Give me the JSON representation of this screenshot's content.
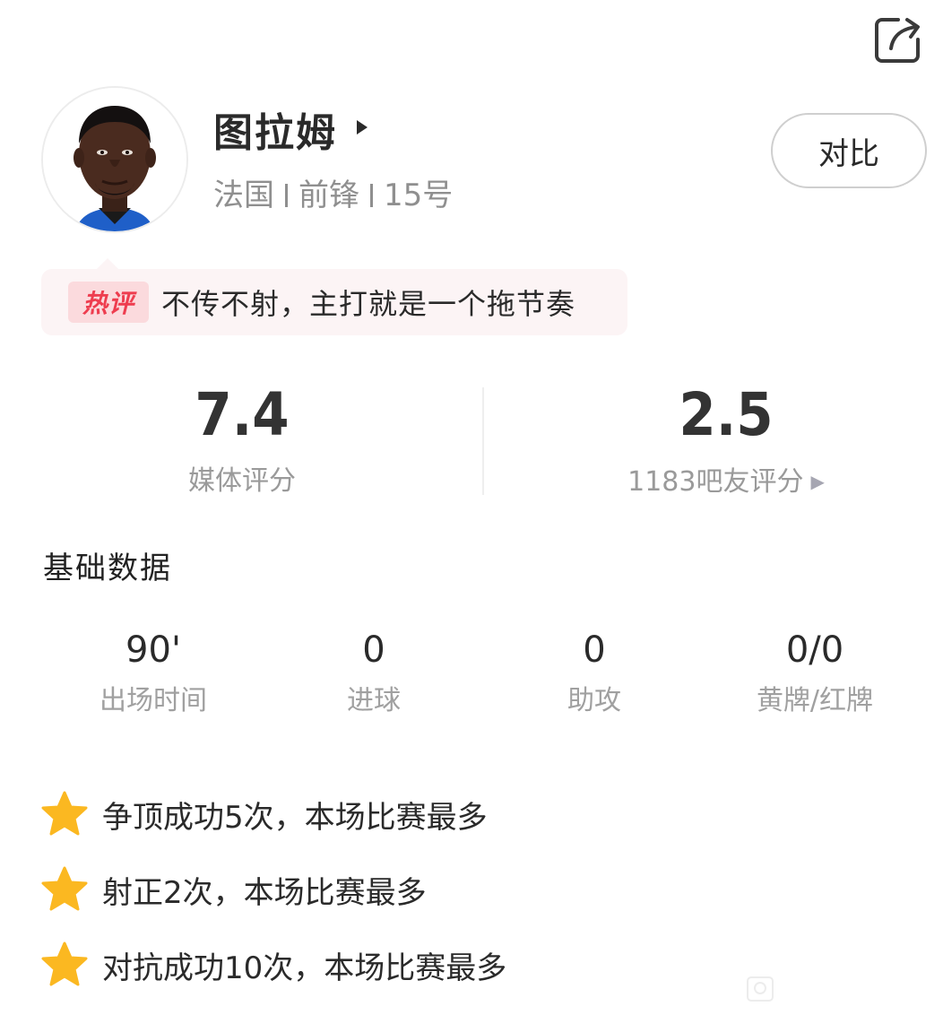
{
  "player": {
    "name": "图拉姆",
    "nationality": "法国",
    "position": "前锋",
    "number": "15号",
    "avatar_icon": "player-photo",
    "name_arrow_icon": "play-triangle-icon"
  },
  "actions": {
    "compare_label": "对比",
    "share_icon": "share-icon"
  },
  "hot_comment": {
    "tag": "热评",
    "text": "不传不射，主打就是一个拖节奏"
  },
  "ratings": {
    "media": {
      "value": "7.4",
      "label": "媒体评分"
    },
    "fans": {
      "value": "2.5",
      "label": "1183吧友评分"
    }
  },
  "basic_stats": {
    "title": "基础数据",
    "items": [
      {
        "value": "90'",
        "label": "出场时间"
      },
      {
        "value": "0",
        "label": "进球"
      },
      {
        "value": "0",
        "label": "助攻"
      },
      {
        "value": "0/0",
        "label": "黄牌/红牌"
      }
    ]
  },
  "highlights": [
    {
      "icon": "star-icon",
      "text": "争顶成功5次，本场比赛最多"
    },
    {
      "icon": "star-icon",
      "text": "射正2次，本场比赛最多"
    },
    {
      "icon": "star-icon",
      "text": "对抗成功10次，本场比赛最多"
    }
  ],
  "colors": {
    "hot_tag_text": "#ee3d4f",
    "hot_tag_bg": "#fbdadd",
    "hot_box_bg": "#fcf4f5",
    "star": "#fbb821"
  }
}
